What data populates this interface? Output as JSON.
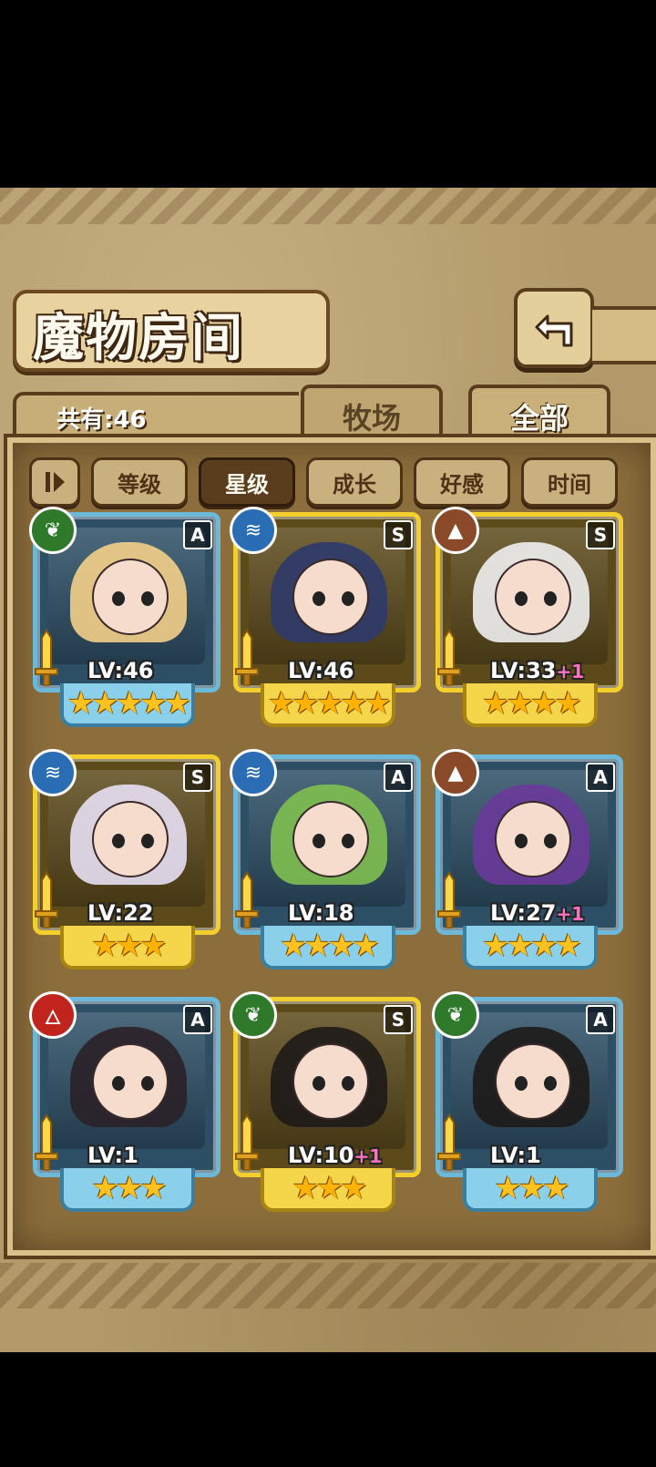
{
  "header": {
    "title": "魔物房间"
  },
  "count": {
    "label": "共有:46"
  },
  "tabs": [
    {
      "label": "牧场",
      "active": false
    },
    {
      "label": "全部",
      "active": true
    }
  ],
  "sort": [
    {
      "label": "等级",
      "active": false
    },
    {
      "label": "星级",
      "active": true
    },
    {
      "label": "成长",
      "active": false
    },
    {
      "label": "好感",
      "active": false
    },
    {
      "label": "时间",
      "active": false
    }
  ],
  "monsters": [
    {
      "rank": "A",
      "element": "grass",
      "level": "LV:46",
      "bonus": "",
      "stars": "★★★★★",
      "hair": "#f3cf88"
    },
    {
      "rank": "S",
      "element": "water",
      "level": "LV:46",
      "bonus": "",
      "stars": "★★★★★",
      "hair": "#2d3a6a"
    },
    {
      "rank": "S",
      "element": "earth",
      "level": "LV:33",
      "bonus": "+1",
      "stars": "★★★★",
      "hair": "#f0f0f0"
    },
    {
      "rank": "S",
      "element": "water",
      "level": "LV:22",
      "bonus": "",
      "stars": "★★★",
      "hair": "#e8e0f4"
    },
    {
      "rank": "A",
      "element": "water",
      "level": "LV:18",
      "bonus": "",
      "stars": "★★★★",
      "hair": "#7fbf50"
    },
    {
      "rank": "A",
      "element": "earth",
      "level": "LV:27",
      "bonus": "+1",
      "stars": "★★★★",
      "hair": "#6a3a9a"
    },
    {
      "rank": "A",
      "element": "fire",
      "level": "LV:1",
      "bonus": "",
      "stars": "★★★",
      "hair": "#2a2028"
    },
    {
      "rank": "S",
      "element": "grass",
      "level": "LV:10",
      "bonus": "+1",
      "stars": "★★★",
      "hair": "#1e1a18"
    },
    {
      "rank": "A",
      "element": "grass",
      "level": "LV:1",
      "bonus": "",
      "stars": "★★★",
      "hair": "#1e1a18"
    }
  ],
  "colors": {
    "grass": "#2f7a2a",
    "water": "#2a6db4",
    "earth": "#8a4a2a",
    "fire": "#c0241c"
  },
  "icons": {
    "back": "back-arrow-icon",
    "sort_toggle": "sort-order-icon",
    "grass": "leaf-icon",
    "water": "wave-icon",
    "earth": "mountain-icon",
    "fire": "flame-icon"
  }
}
